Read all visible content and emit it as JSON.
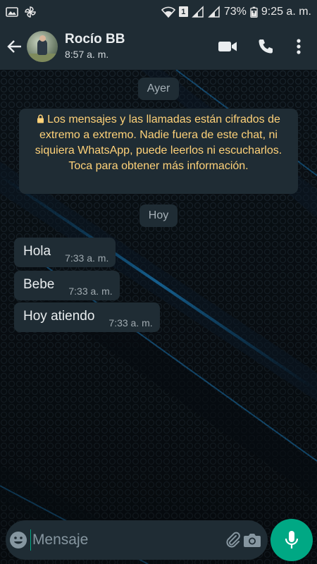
{
  "status_bar": {
    "sim_slot": "1",
    "battery": "73%",
    "time": "9:25 a. m."
  },
  "header": {
    "contact_name": "Rocío BB",
    "contact_status": "8:57 a. m."
  },
  "chat": {
    "date_yesterday": "Ayer",
    "encryption_notice": "Los mensajes y las llamadas están cifrados de extremo a extremo. Nadie fuera de este chat, ni siquiera WhatsApp, puede leerlos ni escucharlos. Toca para obtener más información.",
    "date_today": "Hoy",
    "messages": [
      {
        "text": "Hola",
        "time": "7:33 a. m."
      },
      {
        "text": "Bebe",
        "time": "7:33 a. m."
      },
      {
        "text": "Hoy atiendo",
        "time": "7:33 a. m."
      }
    ]
  },
  "composer": {
    "placeholder": "Mensaje"
  },
  "colors": {
    "bar_background": "#1f2c34",
    "bubble": "#1f2c34",
    "accent_green": "#00a884",
    "notice_text": "#ffd279"
  },
  "icons": {
    "back": "arrow-left-icon",
    "video_call": "video-camera-icon",
    "voice_call": "phone-icon",
    "menu": "more-vertical-icon",
    "emoji": "emoji-icon",
    "attach": "paperclip-icon",
    "camera": "camera-icon",
    "mic": "microphone-icon",
    "lock": "lock-icon"
  }
}
